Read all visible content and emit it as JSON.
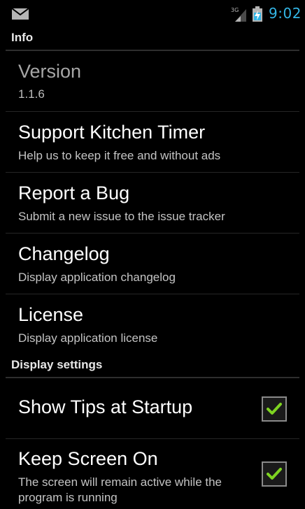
{
  "status_bar": {
    "network": "3G",
    "time": "9:02",
    "icons": [
      "mail-icon",
      "signal-icon",
      "battery-charging-icon"
    ],
    "accent_color": "#33b5e5"
  },
  "info_category": {
    "label": "Info"
  },
  "info_items": [
    {
      "title": "Version",
      "summary": "1.1.6"
    },
    {
      "title": "Support Kitchen Timer",
      "summary": "Help us to keep it free and without ads"
    },
    {
      "title": "Report a Bug",
      "summary": "Submit a new issue to the issue tracker"
    },
    {
      "title": "Changelog",
      "summary": "Display application changelog"
    },
    {
      "title": "License",
      "summary": "Display application license"
    }
  ],
  "display_category": {
    "label": "Display settings"
  },
  "display_items": [
    {
      "title": "Show Tips at Startup",
      "checked": true
    },
    {
      "title": "Keep Screen On",
      "summary": "The screen will remain active while the program is running",
      "checked": true
    }
  ],
  "colors": {
    "check": "#7ed321"
  }
}
